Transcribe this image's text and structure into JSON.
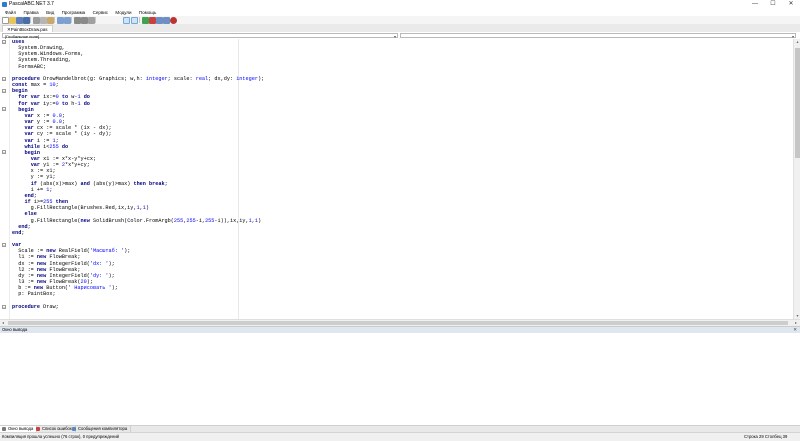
{
  "window": {
    "title": "PascalABC.NET 3.7",
    "minimize_glyph": "—",
    "maximize_glyph": "☐",
    "close_glyph": "✕"
  },
  "menu": [
    "Файл",
    "Правка",
    "Вид",
    "Программа",
    "Сервис",
    "Модули",
    "Помощь"
  ],
  "toolbar": {
    "icons": [
      "new-file-icon",
      "open-icon",
      "save-icon",
      "save-all-icon",
      "cut-icon",
      "copy-icon",
      "paste-icon",
      "undo-icon",
      "redo-icon",
      "comment-icon",
      "uncomment-icon",
      "format-icon",
      "toggle-panel-icon",
      "toggle-output-icon",
      "run-icon",
      "stop-icon",
      "step-into-icon",
      "step-over-icon",
      "breakpoint-icon"
    ]
  },
  "tabs": [
    {
      "label": "✕PaintBoxDraw.pas"
    }
  ],
  "navigation": {
    "scope_value": "[Глобальное поле]",
    "member_value": ""
  },
  "code_lines": [
    [
      [
        "kw",
        "uses"
      ]
    ],
    [
      [
        "t",
        "  System.Drawing,"
      ]
    ],
    [
      [
        "t",
        "  System.Windows.Forms,"
      ]
    ],
    [
      [
        "t",
        "  System.Threading,"
      ]
    ],
    [
      [
        "t",
        "  FormsABC;"
      ]
    ],
    [],
    [
      [
        "kw",
        "procedure"
      ],
      [
        "t",
        " DrowMandelbrot(g: Graphics; w,h: "
      ],
      [
        "ty",
        "integer"
      ],
      [
        "t",
        "; scale: "
      ],
      [
        "ty",
        "real"
      ],
      [
        "t",
        "; dx,dy: "
      ],
      [
        "ty",
        "integer"
      ],
      [
        "t",
        ");"
      ]
    ],
    [
      [
        "kw",
        "const"
      ],
      [
        "t",
        " max = "
      ],
      [
        "num",
        "10"
      ],
      [
        "t",
        ";"
      ]
    ],
    [
      [
        "kw",
        "begin"
      ]
    ],
    [
      [
        "t",
        "  "
      ],
      [
        "kw",
        "for var"
      ],
      [
        "t",
        " ix:="
      ],
      [
        "num",
        "0"
      ],
      [
        "t",
        " "
      ],
      [
        "kw",
        "to"
      ],
      [
        "t",
        " w-"
      ],
      [
        "num",
        "1"
      ],
      [
        "t",
        " "
      ],
      [
        "kw",
        "do"
      ]
    ],
    [
      [
        "t",
        "  "
      ],
      [
        "kw",
        "for var"
      ],
      [
        "t",
        " iy:="
      ],
      [
        "num",
        "0"
      ],
      [
        "t",
        " "
      ],
      [
        "kw",
        "to"
      ],
      [
        "t",
        " h-"
      ],
      [
        "num",
        "1"
      ],
      [
        "t",
        " "
      ],
      [
        "kw",
        "do"
      ]
    ],
    [
      [
        "t",
        "  "
      ],
      [
        "kw",
        "begin"
      ]
    ],
    [
      [
        "t",
        "    "
      ],
      [
        "kw",
        "var"
      ],
      [
        "t",
        " x := "
      ],
      [
        "num",
        "0.0"
      ],
      [
        "t",
        ";"
      ]
    ],
    [
      [
        "t",
        "    "
      ],
      [
        "kw",
        "var"
      ],
      [
        "t",
        " y := "
      ],
      [
        "num",
        "0.0"
      ],
      [
        "t",
        ";"
      ]
    ],
    [
      [
        "t",
        "    "
      ],
      [
        "kw",
        "var"
      ],
      [
        "t",
        " cx := scale * (ix - dx);"
      ]
    ],
    [
      [
        "t",
        "    "
      ],
      [
        "kw",
        "var"
      ],
      [
        "t",
        " cy := scale * (iy - dy);"
      ]
    ],
    [
      [
        "t",
        "    "
      ],
      [
        "kw",
        "var"
      ],
      [
        "t",
        " i := "
      ],
      [
        "num",
        "1"
      ],
      [
        "t",
        ";"
      ]
    ],
    [
      [
        "t",
        "    "
      ],
      [
        "kw",
        "while"
      ],
      [
        "t",
        " i<"
      ],
      [
        "num",
        "255"
      ],
      [
        "t",
        " "
      ],
      [
        "kw",
        "do"
      ]
    ],
    [
      [
        "t",
        "    "
      ],
      [
        "kw",
        "begin"
      ]
    ],
    [
      [
        "t",
        "      "
      ],
      [
        "kw",
        "var"
      ],
      [
        "t",
        " x1 := x*x-y*y+cx;"
      ]
    ],
    [
      [
        "t",
        "      "
      ],
      [
        "kw",
        "var"
      ],
      [
        "t",
        " y1 := "
      ],
      [
        "num",
        "2"
      ],
      [
        "t",
        "*x*y+cy;"
      ]
    ],
    [
      [
        "t",
        "      x := x1;"
      ]
    ],
    [
      [
        "t",
        "      y := y1;"
      ]
    ],
    [
      [
        "t",
        "      "
      ],
      [
        "kw",
        "if"
      ],
      [
        "t",
        " (abs(x)>max) "
      ],
      [
        "kw",
        "and"
      ],
      [
        "t",
        " (abs(y)>max) "
      ],
      [
        "kw",
        "then break"
      ],
      [
        "t",
        ";"
      ]
    ],
    [
      [
        "t",
        "      i += "
      ],
      [
        "num",
        "1"
      ],
      [
        "t",
        ";"
      ]
    ],
    [
      [
        "t",
        "    "
      ],
      [
        "kw",
        "end"
      ],
      [
        "t",
        ";"
      ]
    ],
    [
      [
        "t",
        "    "
      ],
      [
        "kw",
        "if"
      ],
      [
        "t",
        " i>="
      ],
      [
        "num",
        "255"
      ],
      [
        "t",
        " "
      ],
      [
        "kw",
        "then"
      ]
    ],
    [
      [
        "t",
        "      g.FillRectangle(Brushes.Red,ix,iy,"
      ],
      [
        "num",
        "1"
      ],
      [
        "t",
        ","
      ],
      [
        "num",
        "1"
      ],
      [
        "t",
        ")"
      ]
    ],
    [
      [
        "t",
        "    "
      ],
      [
        "kw",
        "else"
      ]
    ],
    [
      [
        "t",
        "      g.FillRectangle("
      ],
      [
        "kw",
        "new"
      ],
      [
        "t",
        " SolidBrush(Color.FromArgb("
      ],
      [
        "num",
        "255"
      ],
      [
        "t",
        ","
      ],
      [
        "num",
        "255"
      ],
      [
        "t",
        "-i,"
      ],
      [
        "num",
        "255"
      ],
      [
        "t",
        "-i)),ix,iy,"
      ],
      [
        "num",
        "1"
      ],
      [
        "t",
        ","
      ],
      [
        "num",
        "1"
      ],
      [
        "t",
        ")"
      ]
    ],
    [
      [
        "t",
        "  "
      ],
      [
        "kw",
        "end"
      ],
      [
        "t",
        ";"
      ]
    ],
    [
      [
        "kw",
        "end"
      ],
      [
        "t",
        ";"
      ]
    ],
    [],
    [
      [
        "kw",
        "var"
      ]
    ],
    [
      [
        "t",
        "  Scale := "
      ],
      [
        "kw",
        "new"
      ],
      [
        "t",
        " RealField("
      ],
      [
        "str",
        "'Масштаб: '"
      ],
      [
        "t",
        ");"
      ]
    ],
    [
      [
        "t",
        "  l1 := "
      ],
      [
        "kw",
        "new"
      ],
      [
        "t",
        " FlowBreak;"
      ]
    ],
    [
      [
        "t",
        "  dx := "
      ],
      [
        "kw",
        "new"
      ],
      [
        "t",
        " IntegerField("
      ],
      [
        "str",
        "'dx: '"
      ],
      [
        "t",
        ");"
      ]
    ],
    [
      [
        "t",
        "  l2 := "
      ],
      [
        "kw",
        "new"
      ],
      [
        "t",
        " FlowBreak;"
      ]
    ],
    [
      [
        "t",
        "  dy := "
      ],
      [
        "kw",
        "new"
      ],
      [
        "t",
        " IntegerField("
      ],
      [
        "str",
        "'dy: '"
      ],
      [
        "t",
        ");"
      ]
    ],
    [
      [
        "t",
        "  l3 := "
      ],
      [
        "kw",
        "new"
      ],
      [
        "t",
        " FlowBreak("
      ],
      [
        "num",
        "20"
      ],
      [
        "t",
        ");"
      ]
    ],
    [
      [
        "t",
        "  b := "
      ],
      [
        "kw",
        "new"
      ],
      [
        "t",
        " Button("
      ],
      [
        "str",
        "' Нарисовать '"
      ],
      [
        "t",
        ");"
      ]
    ],
    [
      [
        "t",
        "  p: PaintBox;"
      ]
    ],
    [],
    [
      [
        "kw",
        "procedure"
      ],
      [
        "t",
        " Draw;"
      ]
    ]
  ],
  "output": {
    "title": "Окно вывода",
    "close_glyph": "✕",
    "text": ""
  },
  "bottom_tabs": [
    "Окно вывода",
    "Список ошибок",
    "Сообщения компилятора"
  ],
  "status": {
    "message": "Компиляция прошла успешно (76 строк), 0 предупреждений",
    "position": "Строка 29   Столбец 39"
  }
}
